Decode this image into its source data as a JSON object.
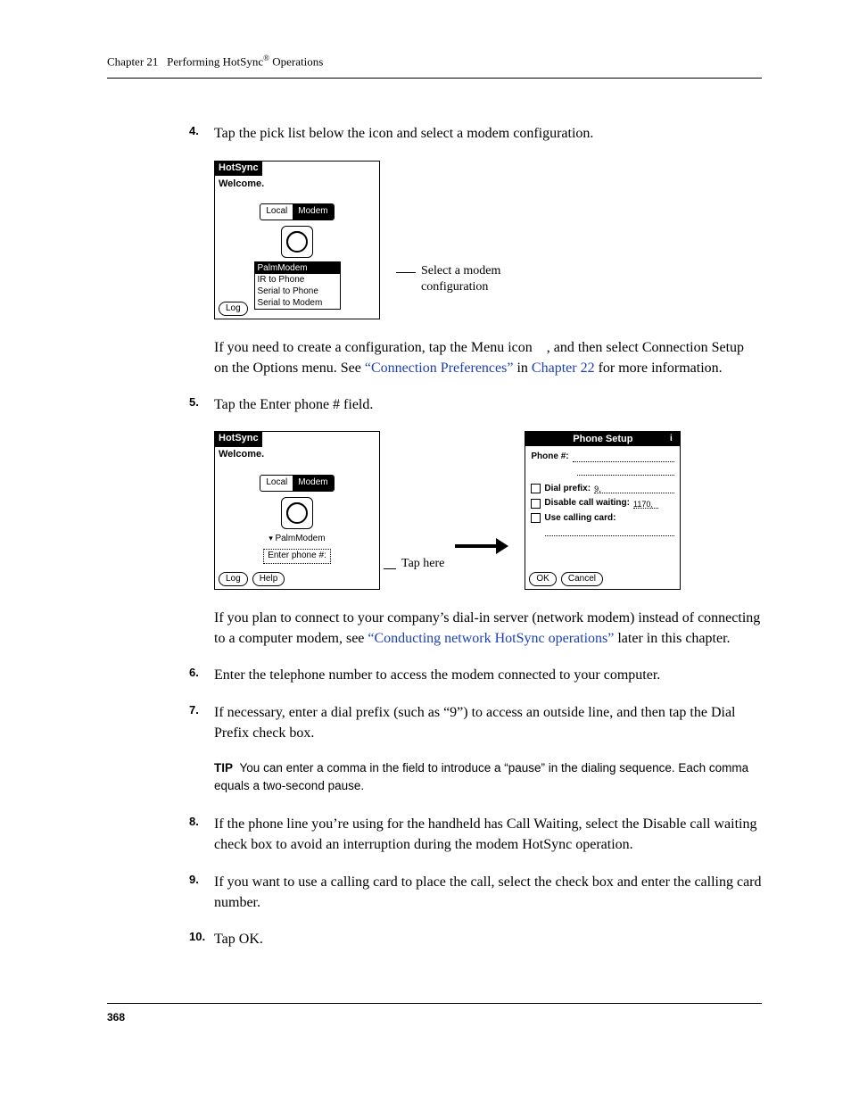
{
  "header": {
    "chapter_label": "Chapter 21",
    "chapter_title_prefix": "Performing HotSync",
    "chapter_title_suffix": " Operations"
  },
  "steps": {
    "s4": {
      "num": "4.",
      "text": "Tap the pick list below the icon and select a modem configuration."
    },
    "s5": {
      "num": "5.",
      "text": "Tap the Enter phone # field."
    },
    "s6": {
      "num": "6.",
      "text": "Enter the telephone number to access the modem connected to your computer."
    },
    "s7": {
      "num": "7.",
      "text": "If necessary, enter a dial prefix (such as “9”) to access an outside line, and then tap the Dial Prefix check box."
    },
    "s8": {
      "num": "8.",
      "text": "If the phone line you’re using for the handheld has Call Waiting, select the Disable call waiting check box to avoid an interruption during the modem HotSync operation."
    },
    "s9": {
      "num": "9.",
      "text": "If you want to use a calling card to place the call, select the check box and enter the calling card number."
    },
    "s10": {
      "num": "10.",
      "text": "Tap OK."
    }
  },
  "para_after_fig1_a": "If you need to create a configuration, tap the Menu icon , and then select Connection Setup on the Options menu. See ",
  "link_conn_pref": "“Connection Preferences”",
  "para_after_fig1_b": " in ",
  "link_ch22": "Chapter 22",
  "para_after_fig1_c": " for more information.",
  "para_after_fig2_a": "If you plan to connect to your company’s dial-in server (network modem) instead of connecting to a computer modem, see ",
  "link_network": "“Conducting network HotSync operations”",
  "para_after_fig2_b": " later in this chapter.",
  "tip": {
    "label": "TIP",
    "text": "You can enter a comma in the field to introduce a “pause” in the dialing sequence. Each comma equals a two-second pause."
  },
  "fig1": {
    "title": "HotSync",
    "welcome": "Welcome.",
    "tab_local": "Local",
    "tab_modem": "Modem",
    "opt1": "PalmModem",
    "opt2": "IR to Phone",
    "opt3": "Serial to Phone",
    "opt4": "Serial to Modem",
    "log_btn": "Log",
    "callout": "Select a modem configuration"
  },
  "fig2_left": {
    "title": "HotSync",
    "welcome": "Welcome.",
    "tab_local": "Local",
    "tab_modem": "Modem",
    "selected": "PalmModem",
    "enter_phone": "Enter phone #:",
    "log_btn": "Log",
    "help_btn": "Help",
    "callout": "Tap here"
  },
  "fig2_right": {
    "title": "Phone Setup",
    "phone_label": "Phone #:",
    "dial_prefix_label": "Dial prefix:",
    "dial_prefix_value": "9,",
    "disable_cw_label": "Disable call waiting:",
    "disable_cw_value": "1170,",
    "calling_card_label": "Use calling card:",
    "ok_btn": "OK",
    "cancel_btn": "Cancel",
    "info": "i"
  },
  "page_number": "368"
}
